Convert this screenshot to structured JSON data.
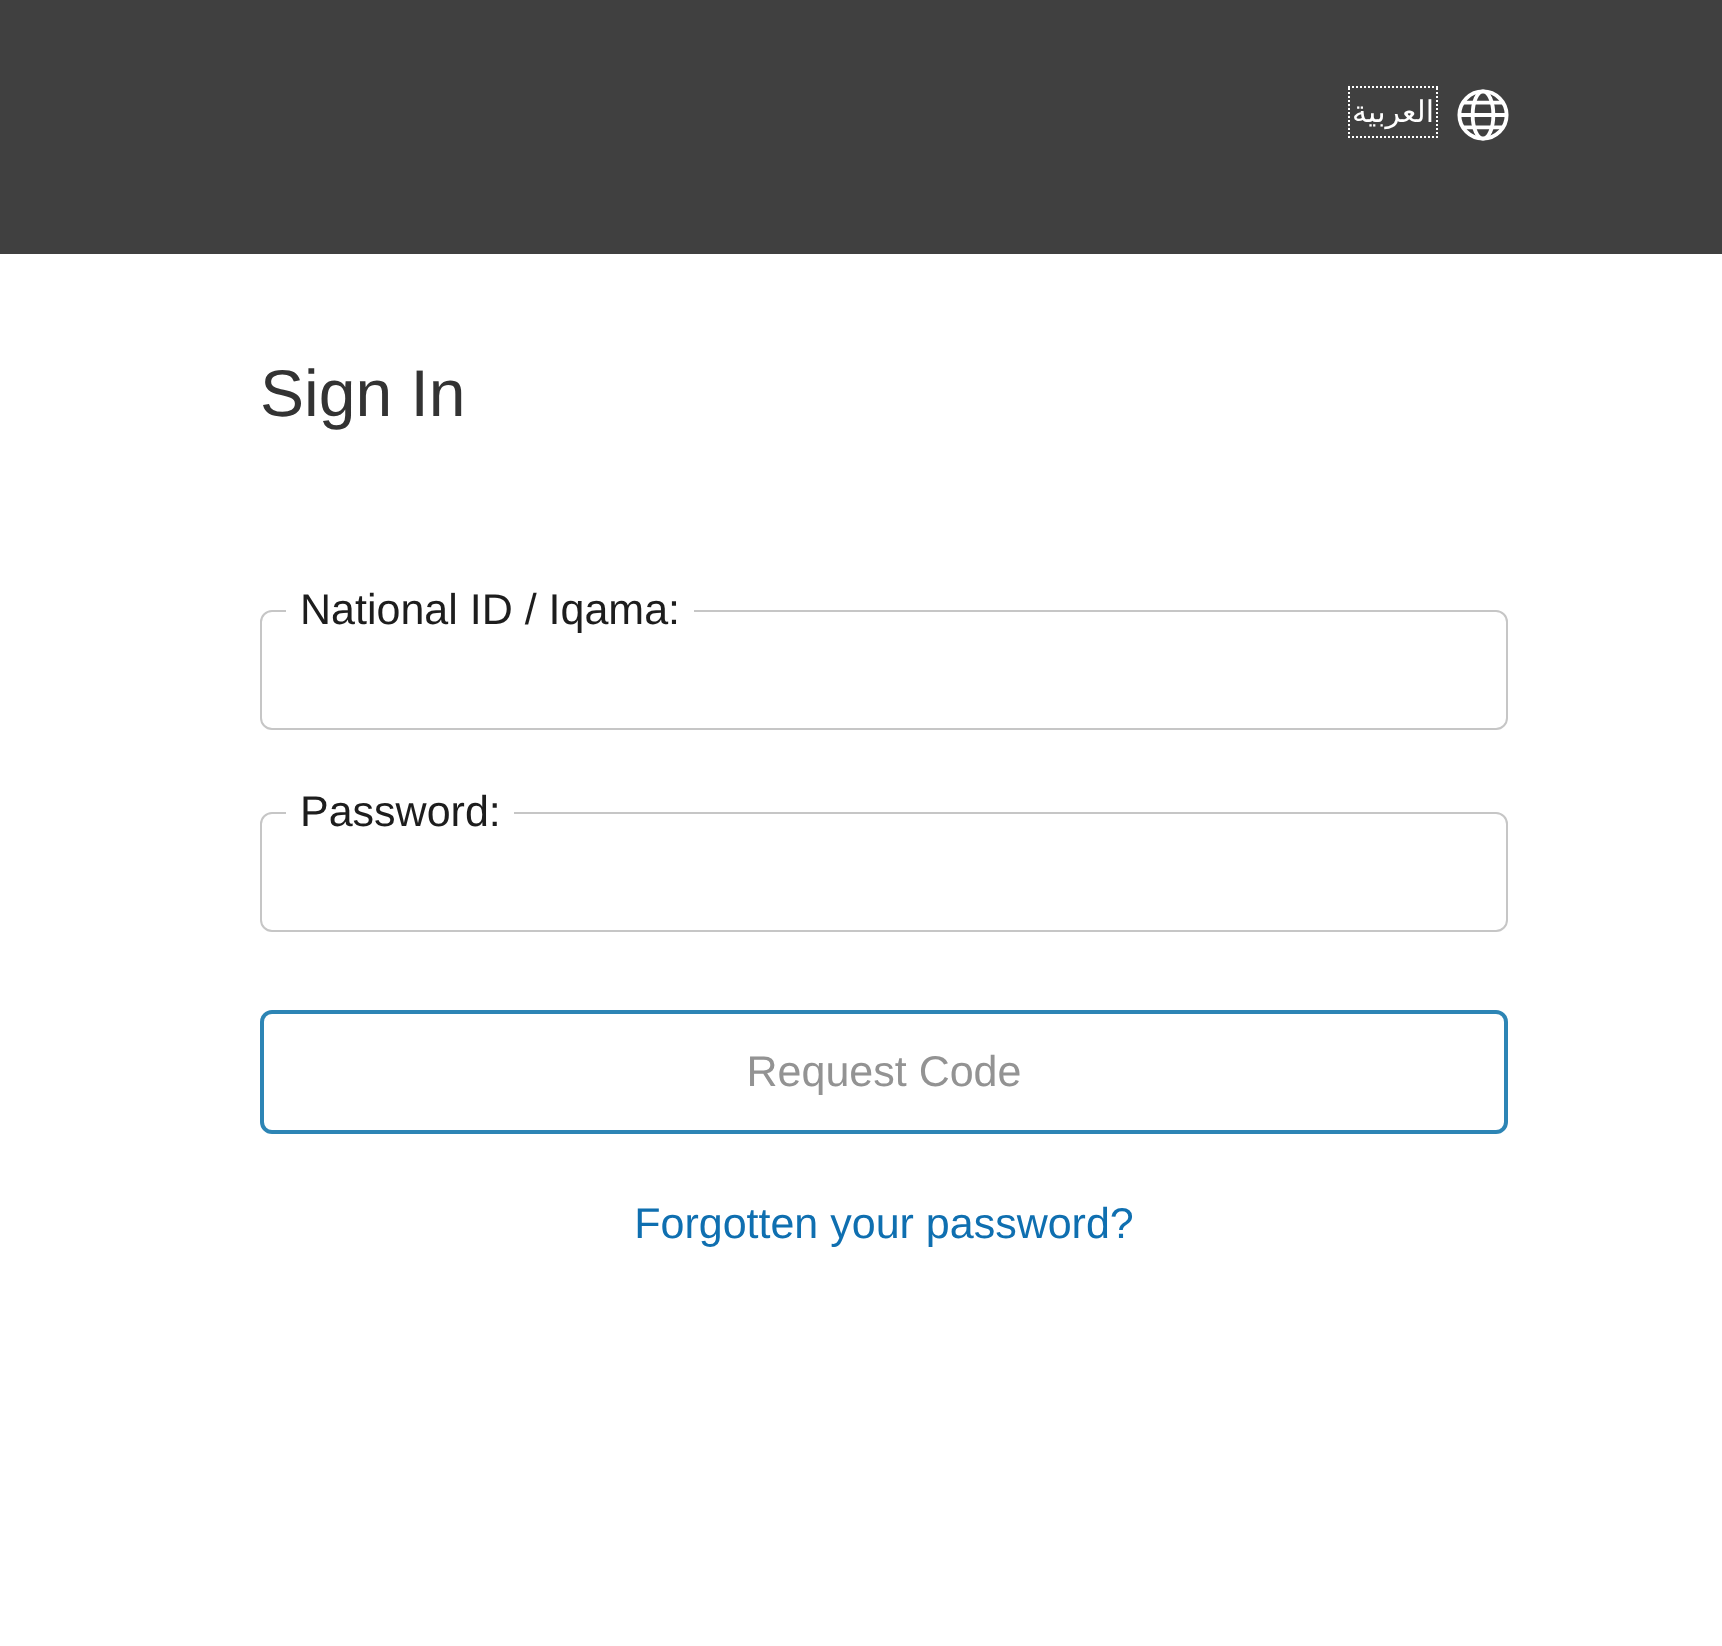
{
  "header": {
    "language_link": {
      "label": "العربية",
      "focused": true
    }
  },
  "title": "Sign In",
  "fields": [
    {
      "label": "National ID / Iqama:"
    },
    {
      "label": "Password:"
    }
  ],
  "button": {
    "label": "Request Code",
    "disabled": true
  },
  "link": {
    "label": "Forgotten your password?"
  }
}
